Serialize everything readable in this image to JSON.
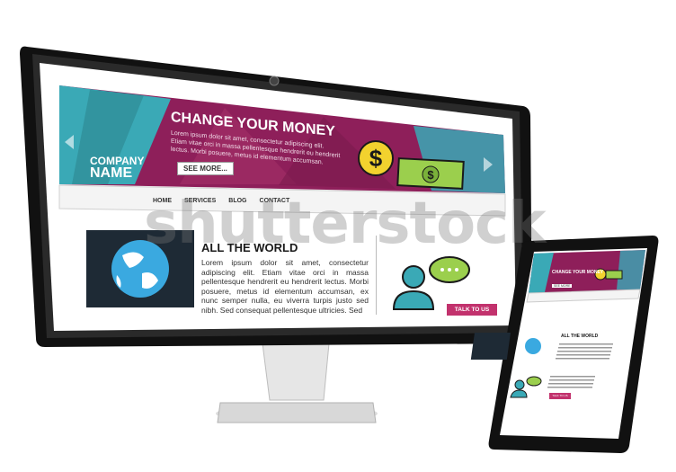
{
  "desktop": {
    "company_line1": "COMPANY",
    "company_line2": "NAME",
    "headline": "CHANGE YOUR MONEY",
    "headline_body": "Lorem ipsum dolor sit amet, consectetur adipiscing elit. Etiam vitae orci in massa pellentesque hendrerit eu hendrerit lectus. Morbi posuere, metus id elementum accumsan.",
    "see_more_label": "SEE MORE...",
    "nav": [
      {
        "label": "HOME"
      },
      {
        "label": "SERVICES"
      },
      {
        "label": "BLOG"
      },
      {
        "label": "CONTACT"
      }
    ],
    "section_title": "ALL THE WORLD",
    "section_body": "Lorem ipsum dolor sit amet, consectetur adipiscing elit. Etiam vitae orci in massa pellentesque hendrerit eu hendrerit lectus. Morbi posuere, metus id elementum accumsan, ex nunc semper nulla, eu viverra turpis justo sed nibh. Sed consequat pellentesque ultricies. Sed",
    "cta_label": "TALK TO US"
  },
  "tablet": {
    "headline": "CHANGE YOUR MONEY",
    "see_more_label": "SEE MORE",
    "section_title": "ALL THE WORLD",
    "cta_label": "TALK TO US"
  },
  "watermark": "shutterstock",
  "colors": {
    "banner_magenta": "#8e1f5a",
    "banner_teal": "#3aa9b6",
    "teal_dark": "#2f8c95",
    "accent_pink": "#c2326d",
    "coin_yellow": "#f2d22e",
    "bill_green": "#9bcf4d",
    "device_black": "#1a1a1a",
    "nav_bg": "#f4f4f4"
  },
  "icons": [
    "globe-icon",
    "people-chat-icon",
    "dollar-coin-icon",
    "banknote-icon",
    "left-arrow-icon",
    "right-arrow-icon"
  ]
}
